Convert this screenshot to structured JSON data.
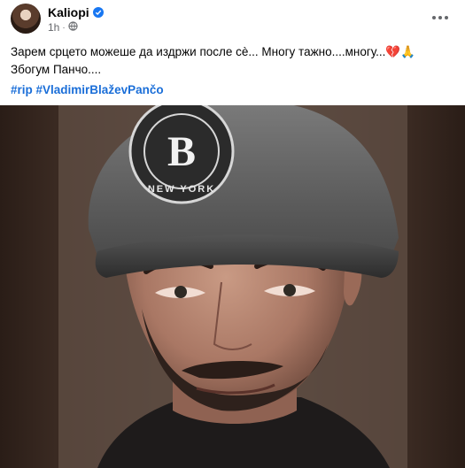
{
  "post": {
    "author": "Kaliopi",
    "time": "1h",
    "privacy_icon": "globe-icon",
    "text_line_1": "Зарем срцето можеше да издржи после сè... Многу тажно....многу...",
    "text_line_1_emoji": "💔🙏",
    "text_line_2": "Збогум Панчо....",
    "hashtags": [
      "#rip",
      "#VladimirBlaževPančo"
    ],
    "cap_logo_text": "NEW YORK",
    "cap_logo_letter": "B"
  },
  "colors": {
    "name": "#050505",
    "meta": "#65676b",
    "hashtag": "#1a6ed8",
    "verified": "#1877f2",
    "photo_frame": "#2b1e18"
  }
}
